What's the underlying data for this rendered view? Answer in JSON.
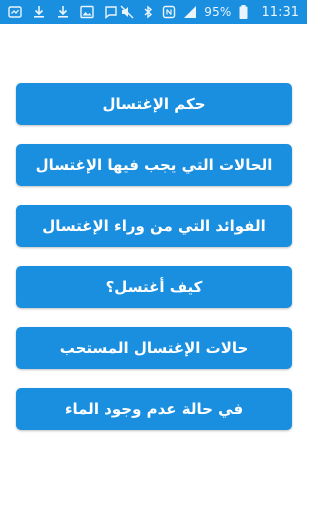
{
  "status_bar": {
    "battery_percent": "95%",
    "time": "11:31",
    "icons_left": [
      "app-notification-icon",
      "download-icon",
      "download-icon",
      "image-icon",
      "message-icon"
    ],
    "icons_right": [
      "mute-icon",
      "bluetooth-icon",
      "nfc-icon",
      "signal-icon",
      "battery-icon"
    ]
  },
  "menu": {
    "items": [
      {
        "label": "حكم الإغتسال"
      },
      {
        "label": "الحالات التي يجب فيها الإغتسال"
      },
      {
        "label": "الفوائد التي من وراء الإغتسال"
      },
      {
        "label": "كيف أغتسل؟"
      },
      {
        "label": "حالات الإغتسال المستحب"
      },
      {
        "label": "في حالة عدم وجود الماء"
      }
    ]
  },
  "colors": {
    "accent": "#1a8fe0",
    "button_text": "#ffffff",
    "background": "#ffffff"
  }
}
